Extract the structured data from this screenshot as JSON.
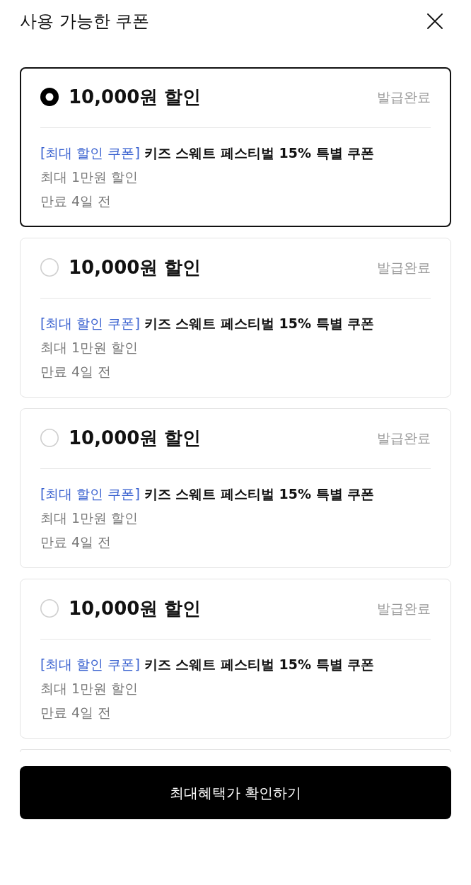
{
  "header": {
    "title": "사용 가능한 쿠폰"
  },
  "coupons": [
    {
      "selected": true,
      "amount": "10,000원 할인",
      "status": "발급완료",
      "tag": "[최대 할인 쿠폰]",
      "name": "키즈 스웨트 페스티벌 15% 특별 쿠폰",
      "max_discount": "최대 1만원 할인",
      "expiry": "만료 4일 전"
    },
    {
      "selected": false,
      "amount": "10,000원 할인",
      "status": "발급완료",
      "tag": "[최대 할인 쿠폰]",
      "name": "키즈 스웨트 페스티벌 15% 특별 쿠폰",
      "max_discount": "최대 1만원 할인",
      "expiry": "만료 4일 전"
    },
    {
      "selected": false,
      "amount": "10,000원 할인",
      "status": "발급완료",
      "tag": "[최대 할인 쿠폰]",
      "name": "키즈 스웨트 페스티벌 15% 특별 쿠폰",
      "max_discount": "최대 1만원 할인",
      "expiry": "만료 4일 전"
    },
    {
      "selected": false,
      "amount": "10,000원 할인",
      "status": "발급완료",
      "tag": "[최대 할인 쿠폰]",
      "name": "키즈 스웨트 페스티벌 15% 특별 쿠폰",
      "max_discount": "최대 1만원 할인",
      "expiry": "만료 4일 전"
    }
  ],
  "confirm_button": {
    "label": "최대혜택가 확인하기"
  }
}
